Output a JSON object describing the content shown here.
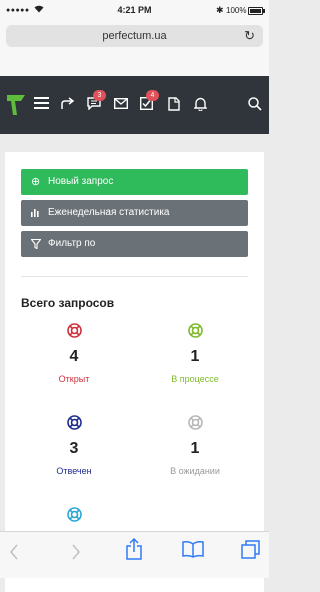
{
  "status": {
    "signal": "●●●●●",
    "time": "4:21 PM",
    "battery": "100%",
    "battery_level": 1.0
  },
  "browser": {
    "url": "perfectum.ua"
  },
  "header": {
    "messages_badge": "3",
    "tasks_badge": "4"
  },
  "actions": {
    "new_request": "Новый запрос",
    "weekly_stats": "Еженедельная статистика",
    "filter": "Фильтр по"
  },
  "summary": {
    "title": "Всего запросов",
    "stats": [
      {
        "count": "4",
        "label": "Открыт",
        "color": "#d0303d"
      },
      {
        "count": "1",
        "label": "В процессе",
        "color": "#7dbb2a"
      },
      {
        "count": "3",
        "label": "Отвечен",
        "color": "#1f2c8f"
      },
      {
        "count": "1",
        "label": "В ожидании",
        "color": "#b7b7b7"
      },
      {
        "color": "#2aa7d6"
      }
    ]
  },
  "colors": {
    "appbar": "#2f353a",
    "accent_green": "#2fba5b",
    "button_grey": "#6b7277",
    "badge": "#e0525a",
    "ios_blue": "#2f7cf6"
  },
  "icons": {
    "logo": "perfectum-logo",
    "menu": "hamburger-icon",
    "share": "share-arrow-icon",
    "messages": "chat-icon",
    "mail": "mail-icon",
    "tasks": "task-check-icon",
    "files": "file-icon",
    "notifications": "bell-icon",
    "search": "search-icon"
  }
}
